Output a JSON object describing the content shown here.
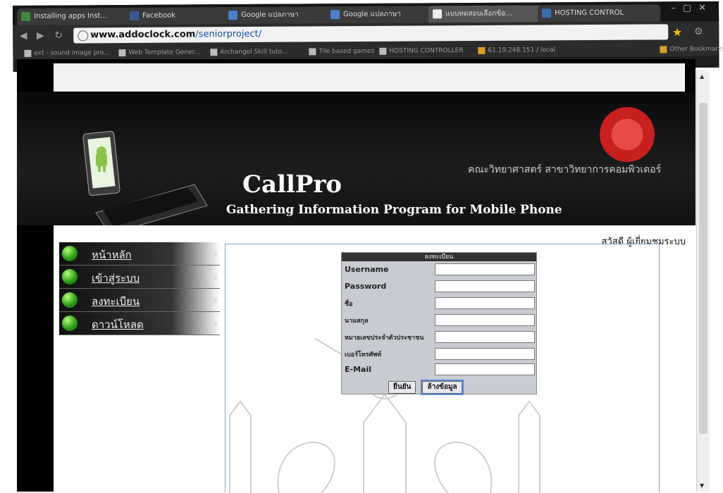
{
  "browser": {
    "tabs": [
      {
        "label": "Installing apps Inst...",
        "color": "#3a8a3a"
      },
      {
        "label": "Facebook",
        "color": "#3b5998"
      },
      {
        "label": "Google แปลภาษา",
        "color": "#4a7fd0"
      },
      {
        "label": "Google แปลภาษา",
        "color": "#4a7fd0"
      },
      {
        "label": "แบบทดสอบเลือกข้อ...",
        "color": "#eeeeee"
      },
      {
        "label": "HOSTING CONTROL",
        "color": "#3a6fb0"
      }
    ],
    "url_domain": "www.addoclock.com",
    "url_path": "/seniorproject/",
    "bookmarks": [
      "ext - sound image pro...",
      "Web Template Gener...",
      "Archangel Skill tuto...",
      "Tile based games",
      "HOSTING CONTROLLER",
      "61.19.248.151 / local"
    ],
    "other_bookmarks": "Other Bookmarks"
  },
  "header": {
    "department": "คณะวิทยาศาสตร์ สาขาวิทยาการคอมพิวเตอร์",
    "brand": "CallPro",
    "tagline": "Gathering Information Program for Mobile Phone"
  },
  "greeting": "สวัสดี ผู้เยี่ยมชมระบบ",
  "sidebar": {
    "items": [
      "หน้าหลัก",
      "เข้าสู่ระบบ",
      "ลงทะเบียน",
      "ดาวน์โหลด"
    ]
  },
  "form": {
    "title": "ลงทะเบียน",
    "fields": [
      {
        "label": "Username"
      },
      {
        "label": "Password"
      },
      {
        "label": "ชื่อ"
      },
      {
        "label": "นามสกุล"
      },
      {
        "label": "หมายเลขประจำตัวประชาชน"
      },
      {
        "label": "เบอร์โทรศัพท์"
      },
      {
        "label": "E-Mail"
      }
    ],
    "submit_label": "ยืนยัน",
    "reset_label": "ล้างข้อมูล"
  },
  "colors": {
    "page_bg": "#000000",
    "link_border": "#7aa6d6",
    "nav_orb": "#2e9e1a"
  }
}
